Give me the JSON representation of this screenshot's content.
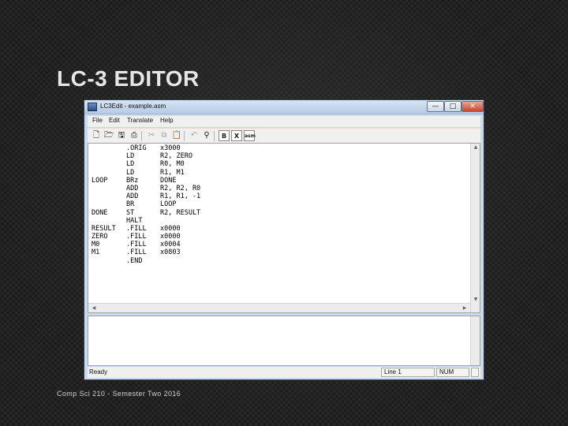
{
  "slide": {
    "title": "LC-3 EDITOR",
    "footer": "Comp Sci 210 - Semester Two 2016"
  },
  "window": {
    "title": "LC3Edit - example.asm",
    "buttons": {
      "minimize": "—",
      "maximize": "□",
      "close": "✕"
    }
  },
  "menu": [
    "File",
    "Edit",
    "Translate",
    "Help"
  ],
  "toolbar": {
    "icons": [
      "new-file-icon",
      "open-folder-icon",
      "save-icon",
      "print-icon",
      "cut-icon",
      "copy-icon",
      "paste-icon",
      "undo-icon",
      "find-icon",
      "assemble-icon",
      "convert-icon",
      "translate-icon"
    ],
    "b_label": "B",
    "x_label": "X",
    "asm_label": "asm"
  },
  "code": [
    {
      "label": "",
      "op": ".ORIG",
      "arg": "x3000"
    },
    {
      "label": "",
      "op": "LD",
      "arg": "R2, ZERO"
    },
    {
      "label": "",
      "op": "LD",
      "arg": "R0, M0"
    },
    {
      "label": "",
      "op": "LD",
      "arg": "R1, M1"
    },
    {
      "label": "LOOP",
      "op": "BRz",
      "arg": "DONE"
    },
    {
      "label": "",
      "op": "ADD",
      "arg": "R2, R2, R0"
    },
    {
      "label": "",
      "op": "ADD",
      "arg": "R1, R1, -1"
    },
    {
      "label": "",
      "op": "BR",
      "arg": "LOOP"
    },
    {
      "label": "DONE",
      "op": "ST",
      "arg": "R2, RESULT"
    },
    {
      "label": "",
      "op": "HALT",
      "arg": ""
    },
    {
      "label": "RESULT",
      "op": ".FILL",
      "arg": "x0000"
    },
    {
      "label": "ZERO",
      "op": ".FILL",
      "arg": "x0000"
    },
    {
      "label": "M0",
      "op": ".FILL",
      "arg": "x0004"
    },
    {
      "label": "M1",
      "op": ".FILL",
      "arg": "x0803"
    },
    {
      "label": "",
      "op": ".END",
      "arg": ""
    }
  ],
  "status": {
    "text": "Ready",
    "line": "Line 1",
    "num": "NUM"
  }
}
